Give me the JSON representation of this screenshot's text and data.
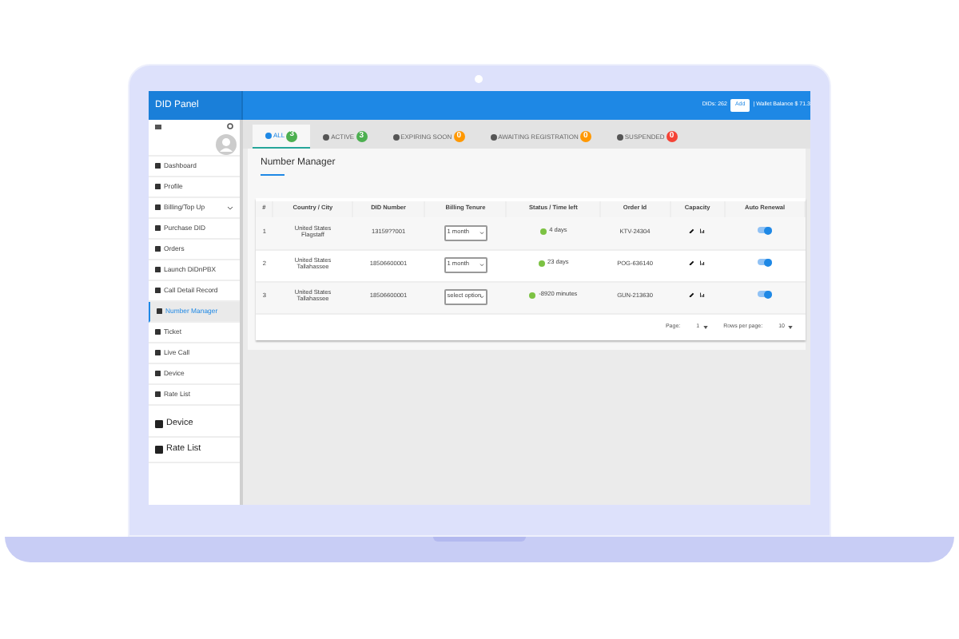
{
  "topbar": {
    "brand": "DID Panel",
    "dids": "DIDs: 262",
    "add_button": "Add",
    "wallet": "| Wallet Balance $ 71.3"
  },
  "sidebar": {
    "items": [
      {
        "label": "Dashboard",
        "selected": false
      },
      {
        "label": "Profile",
        "selected": false
      },
      {
        "label": "Billing/Top Up",
        "selected": false,
        "expandable": true
      },
      {
        "label": "Purchase DID",
        "selected": false
      },
      {
        "label": "Orders",
        "selected": false
      },
      {
        "label": "Launch DiDnPBX",
        "selected": false
      },
      {
        "label": "Call Detail Record",
        "selected": false
      },
      {
        "label": "Number Manager",
        "selected": true
      },
      {
        "label": "Ticket",
        "selected": false
      },
      {
        "label": "Live Call",
        "selected": false
      },
      {
        "label": "Device",
        "selected": false
      },
      {
        "label": "Rate List",
        "selected": false
      }
    ],
    "large_items": [
      "Device",
      "Rate List"
    ]
  },
  "tabs": [
    {
      "label": "ALL",
      "count": "3",
      "color": "#4caf50",
      "selected": true
    },
    {
      "label": "ACTIVE",
      "count": "3",
      "color": "#4caf50",
      "selected": false
    },
    {
      "label": "EXPIRING SOON",
      "count": "0",
      "color": "#ff9800",
      "selected": false
    },
    {
      "label": "AWAITING REGISTRATION",
      "count": "0",
      "color": "#ff9800",
      "selected": false
    },
    {
      "label": "SUSPENDED",
      "count": "0",
      "color": "#f44336",
      "selected": false
    }
  ],
  "page_title": "Number Manager",
  "table": {
    "columns": [
      "#",
      "Country / City",
      "DID Number",
      "Billing Tenure",
      "Status / Time left",
      "Order Id",
      "Capacity",
      "Auto Renewal"
    ],
    "rows": [
      {
        "index": "1",
        "country": "United States",
        "city": "Flagstaff",
        "did": "13159??001",
        "tenure": "1 month",
        "status": "4 days",
        "order": "KTV-24304",
        "auto_renewal": true
      },
      {
        "index": "2",
        "country": "United States",
        "city": "Tallahassee",
        "did": "18506600001",
        "tenure": "1 month",
        "status": "23 days",
        "order": "POG-636140",
        "auto_renewal": true
      },
      {
        "index": "3",
        "country": "United States",
        "city": "Tallahassee",
        "did": "18506600001",
        "tenure": "select option",
        "status": "-8920 minutes",
        "order": "GUN-213630",
        "auto_renewal": true
      }
    ]
  },
  "pagination": {
    "page_label": "Page:",
    "page": "1",
    "rows_label": "Rows per page:",
    "rows": "10"
  }
}
